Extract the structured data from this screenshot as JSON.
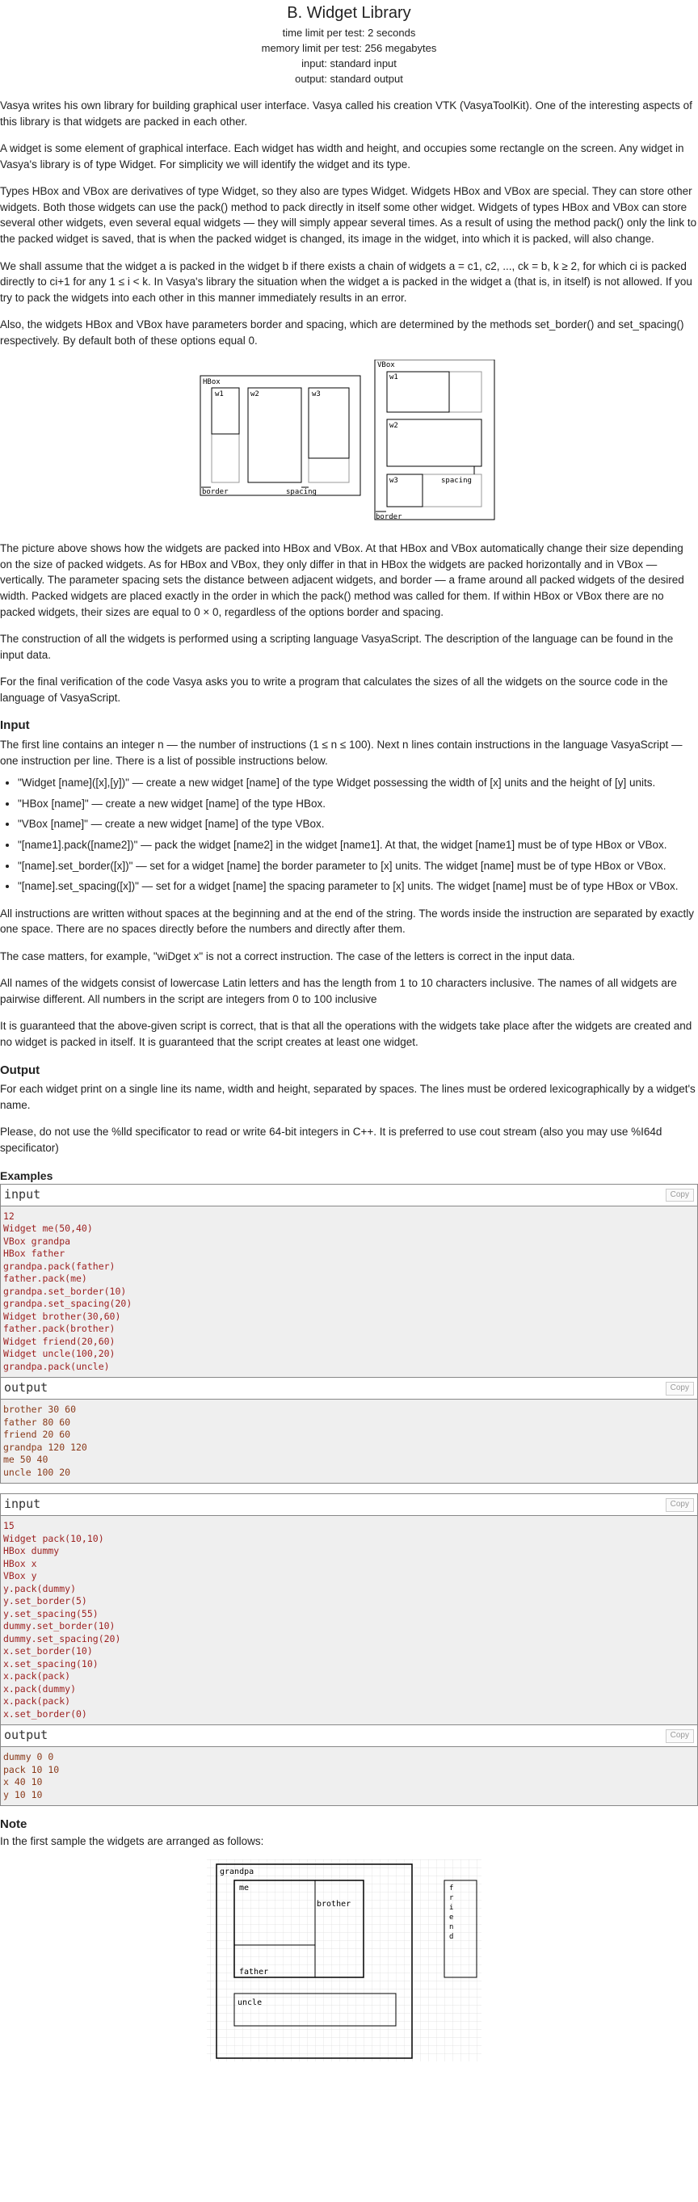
{
  "header": {
    "title": "B. Widget Library",
    "time_limit": "time limit per test: 2 seconds",
    "memory_limit": "memory limit per test: 256 megabytes",
    "input": "input: standard input",
    "output": "output: standard output"
  },
  "paragraphs": {
    "p1": "Vasya writes his own library for building graphical user interface. Vasya called his creation VTK (VasyaToolKit). One of the interesting aspects of this library is that widgets are packed in each other.",
    "p2": "A widget is some element of graphical interface. Each widget has width and height, and occupies some rectangle on the screen. Any widget in Vasya's library is of type Widget. For simplicity we will identify the widget and its type.",
    "p3": "Types HBox and VBox are derivatives of type Widget, so they also are types Widget. Widgets HBox and VBox are special. They can store other widgets. Both those widgets can use the pack() method to pack directly in itself some other widget. Widgets of types HBox and VBox can store several other widgets, even several equal widgets — they will simply appear several times. As a result of using the method pack() only the link to the packed widget is saved, that is when the packed widget is changed, its image in the widget, into which it is packed, will also change.",
    "p4": "We shall assume that the widget a is packed in the widget b if there exists a chain of widgets a = c1, c2, ..., ck = b, k ≥ 2, for which ci is packed directly to ci+1 for any 1 ≤ i < k. In Vasya's library the situation when the widget a is packed in the widget a (that is, in itself) is not allowed. If you try to pack the widgets into each other in this manner immediately results in an error.",
    "p5": "Also, the widgets HBox and VBox have parameters border and spacing, which are determined by the methods set_border() and set_spacing() respectively. By default both of these options equal 0.",
    "p6": "The picture above shows how the widgets are packed into HBox and VBox. At that HBox and VBox automatically change their size depending on the size of packed widgets. As for HBox and VBox, they only differ in that in HBox the widgets are packed horizontally and in VBox — vertically. The parameter spacing sets the distance between adjacent widgets, and border — a frame around all packed widgets of the desired width. Packed widgets are placed exactly in the order in which the pack() method was called for them. If within HBox or VBox there are no packed widgets, their sizes are equal to 0 × 0, regardless of the options border and spacing.",
    "p7": "The construction of all the widgets is performed using a scripting language VasyaScript. The description of the language can be found in the input data.",
    "p8": "For the final verification of the code Vasya asks you to write a program that calculates the sizes of all the widgets on the source code in the language of VasyaScript."
  },
  "input_section": {
    "heading": "Input",
    "intro": "The first line contains an integer n — the number of instructions (1 ≤ n ≤ 100). Next n lines contain instructions in the language VasyaScript — one instruction per line. There is a list of possible instructions below.",
    "items": [
      "\"Widget [name]([x],[y])\" — create a new widget [name] of the type Widget possessing the width of [x] units and the height of [y] units.",
      "\"HBox [name]\" — create a new widget [name] of the type HBox.",
      "\"VBox [name]\" — create a new widget [name] of the type VBox.",
      "\"[name1].pack([name2])\" — pack the widget [name2] in the widget [name1]. At that, the widget [name1] must be of type HBox or VBox.",
      "\"[name].set_border([x])\" — set for a widget [name] the border parameter to [x] units. The widget [name] must be of type HBox or VBox.",
      "\"[name].set_spacing([x])\" — set for a widget [name] the spacing parameter to [x] units. The widget [name] must be of type HBox or VBox."
    ],
    "after1": "All instructions are written without spaces at the beginning and at the end of the string. The words inside the instruction are separated by exactly one space. There are no spaces directly before the numbers and directly after them.",
    "after2": "The case matters, for example, \"wiDget x\" is not a correct instruction. The case of the letters is correct in the input data.",
    "after3": "All names of the widgets consist of lowercase Latin letters and has the length from 1 to 10 characters inclusive. The names of all widgets are pairwise different. All numbers in the script are integers from 0 to 100 inclusive",
    "after4": "It is guaranteed that the above-given script is correct, that is that all the operations with the widgets take place after the widgets are created and no widget is packed in itself. It is guaranteed that the script creates at least one widget."
  },
  "output_section": {
    "heading": "Output",
    "text1": "For each widget print on a single line its name, width and height, separated by spaces. The lines must be ordered lexicographically by a widget's name.",
    "text2": "Please, do not use the %lld specificator to read or write 64-bit integers in C++. It is preferred to use cout stream (also you may use %I64d specificator)"
  },
  "examples": {
    "heading": "Examples",
    "input_label": "input",
    "output_label": "output",
    "copy_label": "Copy",
    "ex1_input": "12\nWidget me(50,40)\nVBox grandpa\nHBox father\ngrandpa.pack(father)\nfather.pack(me)\ngrandpa.set_border(10)\ngrandpa.set_spacing(20)\nWidget brother(30,60)\nfather.pack(brother)\nWidget friend(20,60)\nWidget uncle(100,20)\ngrandpa.pack(uncle)",
    "ex1_output": "brother 30 60\nfather 80 60\nfriend 20 60\ngrandpa 120 120\nme 50 40\nuncle 100 20",
    "ex2_input": "15\nWidget pack(10,10)\nHBox dummy\nHBox x\nVBox y\ny.pack(dummy)\ny.set_border(5)\ny.set_spacing(55)\ndummy.set_border(10)\ndummy.set_spacing(20)\nx.set_border(10)\nx.set_spacing(10)\nx.pack(pack)\nx.pack(dummy)\nx.pack(pack)\nx.set_border(0)",
    "ex2_output": "dummy 0 0\npack 10 10\nx 40 10\ny 10 10"
  },
  "note": {
    "heading": "Note",
    "text": "In the first sample the widgets are arranged as follows:"
  },
  "figure1": {
    "hbox": "HBox",
    "vbox": "VBox",
    "w1": "w1",
    "w2": "w2",
    "w3": "w3",
    "border": "border",
    "spacing": "spacing"
  },
  "figure2": {
    "grandpa": "grandpa",
    "me": "me",
    "brother": "brother",
    "father": "father",
    "uncle": "uncle",
    "friend": "friend"
  }
}
